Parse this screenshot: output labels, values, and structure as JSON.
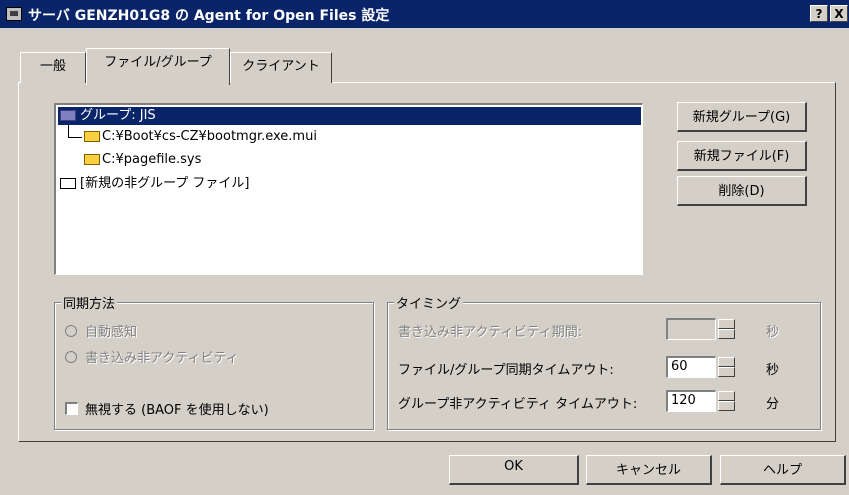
{
  "window": {
    "title": "サーバ GENZH01G8 の Agent for Open Files 設定",
    "help_label": "?",
    "close_label": "X"
  },
  "tabs": [
    {
      "label": "一般",
      "active": false
    },
    {
      "label": "ファイル/グループ",
      "active": true
    },
    {
      "label": "クライアント",
      "active": false
    }
  ],
  "tree": {
    "items": [
      {
        "label": "グループ: JIS",
        "selected": true
      },
      {
        "label": "C:¥Boot¥cs-CZ¥bootmgr.exe.mui"
      },
      {
        "label": "C:¥pagefile.sys"
      },
      {
        "label": "[新規の非グループ ファイル]"
      }
    ]
  },
  "buttons": {
    "new_group": "新規グループ(G)",
    "new_file": "新規ファイル(F)",
    "delete": "削除(D)"
  },
  "sync": {
    "legend": "同期方法",
    "auto_detect": "自動感知",
    "write_inactivity": "書き込み非アクティビティ",
    "ignore": "無視する (BAOF を使用しない)"
  },
  "timing": {
    "legend": "タイミング",
    "rows": [
      {
        "label": "書き込み非アクティビティ期間:",
        "value": "",
        "unit": "秒"
      },
      {
        "label": "ファイル/グループ同期タイムアウト:",
        "value": "60",
        "unit": "秒"
      },
      {
        "label": "グループ非アクティビティ タイムアウト:",
        "value": "120",
        "unit": "分"
      }
    ]
  },
  "footer": {
    "ok": "OK",
    "cancel": "キャンセル",
    "help": "ヘルプ"
  }
}
